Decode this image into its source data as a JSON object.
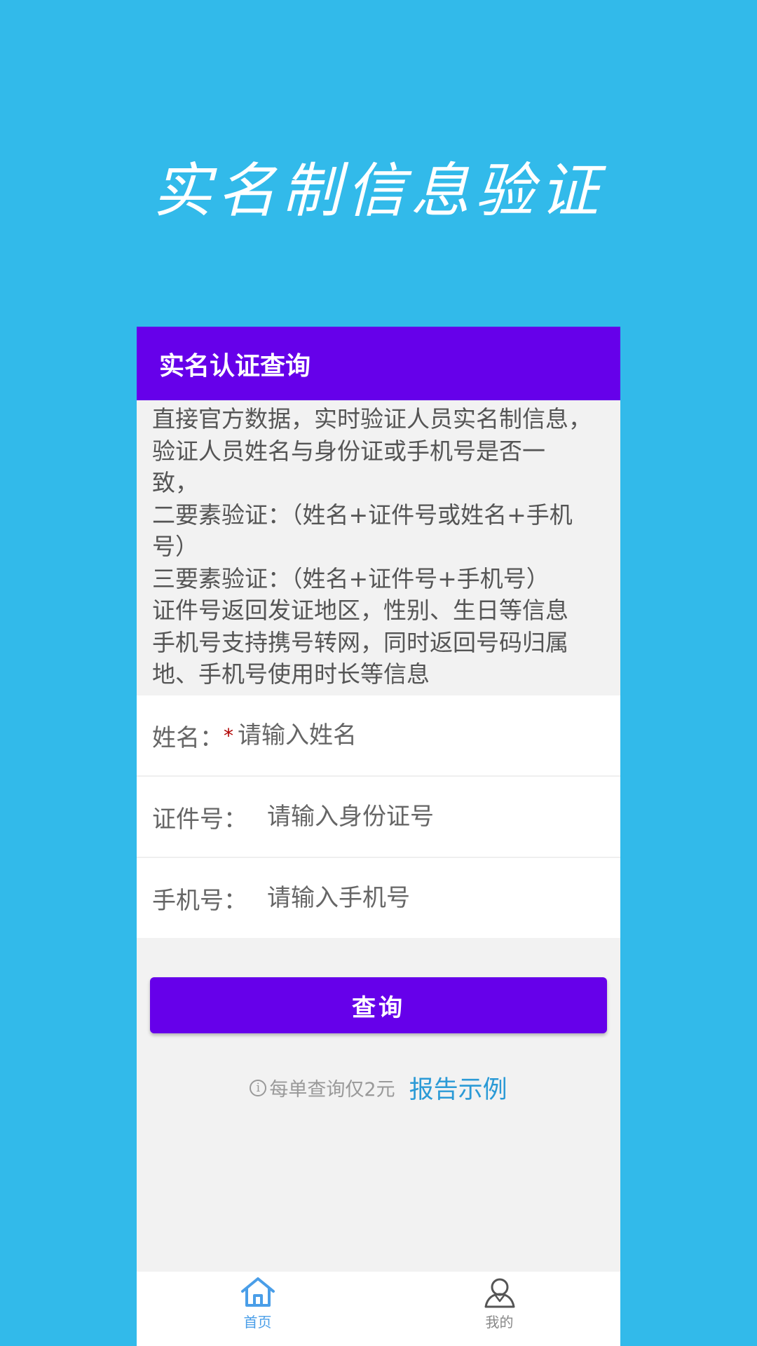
{
  "hero": {
    "title": "实名制信息验证"
  },
  "app_bar": {
    "title": "实名认证查询"
  },
  "description": {
    "lines": [
      "直接官方数据，实时验证人员实名制信息，",
      "验证人员姓名与身份证或手机号是否一",
      "致，",
      "二要素验证：（姓名+证件号或姓名+手机",
      "号）",
      "三要素验证：（姓名+证件号+手机号）",
      "证件号返回发证地区，性别、生日等信息",
      "手机号支持携号转网，同时返回号码归属",
      "地、手机号使用时长等信息"
    ]
  },
  "form": {
    "name": {
      "label": "姓名：",
      "required_mark": "*",
      "placeholder": "请输入姓名",
      "value": ""
    },
    "id_number": {
      "label": "证件号：",
      "placeholder": "请输入身份证号",
      "value": ""
    },
    "phone": {
      "label": "手机号：",
      "placeholder": "请输入手机号",
      "value": ""
    }
  },
  "actions": {
    "query_label": "查询"
  },
  "price": {
    "info_icon": "info-circle-icon",
    "text": "每单查询仅2元",
    "report_link": "报告示例"
  },
  "tabbar": {
    "tabs": [
      {
        "label": "首页",
        "icon": "home-icon",
        "active": true
      },
      {
        "label": "我的",
        "icon": "user-icon",
        "active": false
      }
    ]
  },
  "colors": {
    "background": "#32baea",
    "accent": "#6600ea",
    "link": "#2b9ad6",
    "tab_active": "#4a9ee8"
  }
}
